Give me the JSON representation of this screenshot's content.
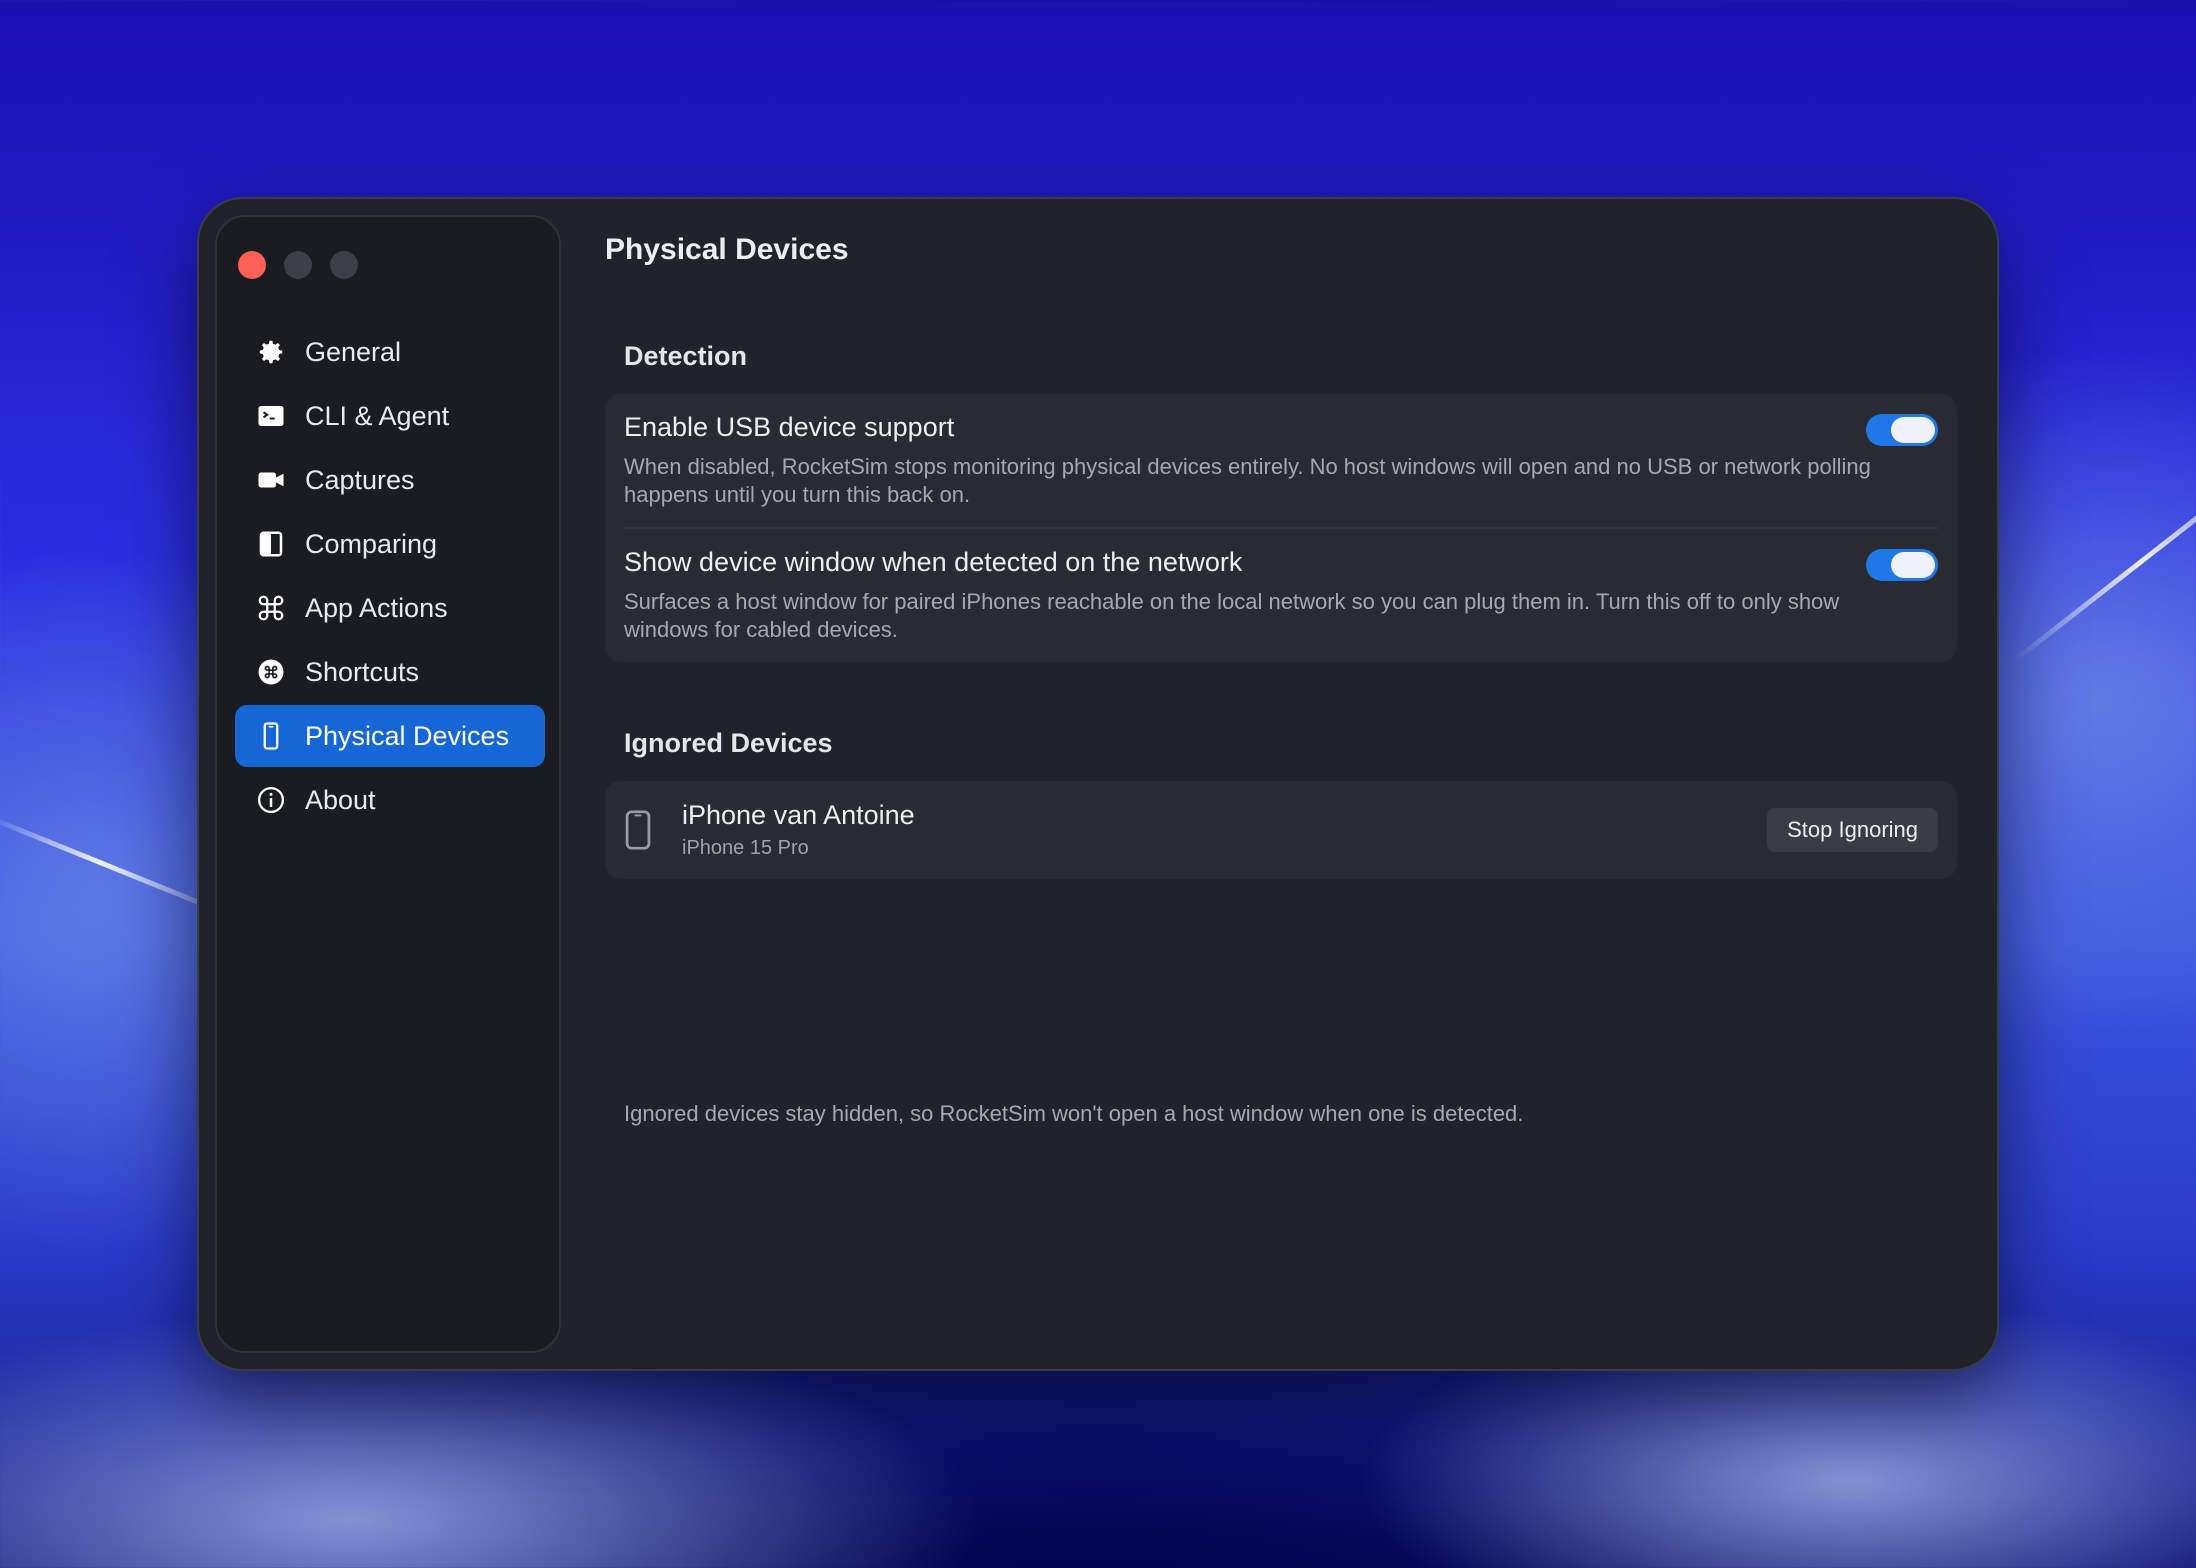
{
  "sidebar": {
    "items": [
      {
        "label": "General",
        "icon": "gear-icon"
      },
      {
        "label": "CLI & Agent",
        "icon": "terminal-icon"
      },
      {
        "label": "Captures",
        "icon": "video-camera-icon"
      },
      {
        "label": "Comparing",
        "icon": "split-square-icon"
      },
      {
        "label": "App Actions",
        "icon": "command-icon"
      },
      {
        "label": "Shortcuts",
        "icon": "command-circle-icon"
      },
      {
        "label": "Physical Devices",
        "icon": "iphone-icon",
        "active": true
      },
      {
        "label": "About",
        "icon": "info-circle-icon"
      }
    ]
  },
  "main": {
    "title": "Physical Devices",
    "detection": {
      "heading": "Detection",
      "usb": {
        "title": "Enable USB device support",
        "description": "When disabled, RocketSim stops monitoring physical devices entirely. No host windows will open and no USB or network polling happens until you turn this back on.",
        "enabled": true
      },
      "network": {
        "title": "Show device window when detected on the network",
        "description": "Surfaces a host window for paired iPhones reachable on the local network so you can plug them in. Turn this off to only show windows for cabled devices.",
        "enabled": true
      }
    },
    "ignored": {
      "heading": "Ignored Devices",
      "device_name": "iPhone van Antoine",
      "device_model": "iPhone 15 Pro",
      "button_label": "Stop Ignoring",
      "footnote": "Ignored devices stay hidden, so RocketSim won't open a host window when one is detected."
    }
  },
  "colors": {
    "accent": "#1766d6",
    "toggle_on": "#1f78e6",
    "close_button": "#fe5f57"
  }
}
